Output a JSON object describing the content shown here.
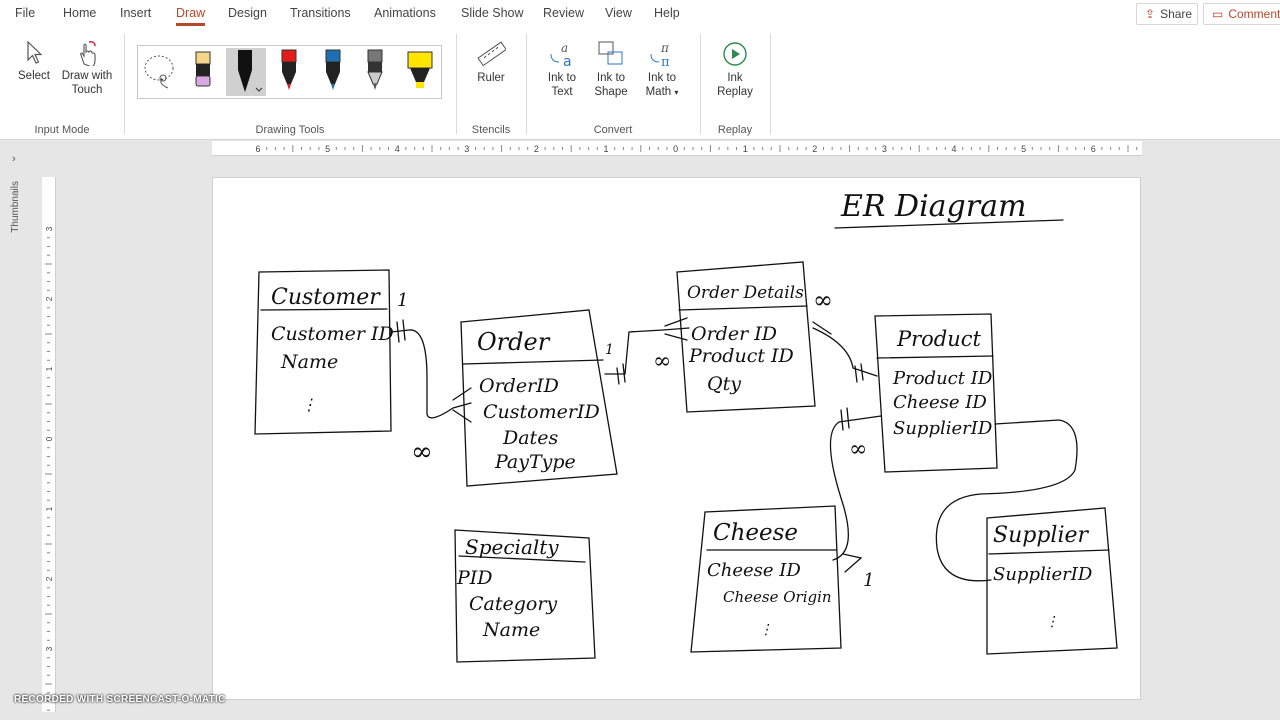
{
  "tabs": [
    {
      "label": "File"
    },
    {
      "label": "Home"
    },
    {
      "label": "Insert"
    },
    {
      "label": "Draw"
    },
    {
      "label": "Design"
    },
    {
      "label": "Transitions"
    },
    {
      "label": "Animations"
    },
    {
      "label": "Slide Show"
    },
    {
      "label": "Review"
    },
    {
      "label": "View"
    },
    {
      "label": "Help"
    }
  ],
  "top_right": {
    "share": "Share",
    "comments": "Comments"
  },
  "ribbon": {
    "select": "Select",
    "draw_with_touch": [
      "Draw with",
      "Touch"
    ],
    "input_mode": "Input Mode",
    "drawing_tools": "Drawing Tools",
    "ruler": "Ruler",
    "stencils": "Stencils",
    "ink_to_text": [
      "Ink to",
      "Text"
    ],
    "ink_to_shape": [
      "Ink to",
      "Shape"
    ],
    "ink_to_math": [
      "Ink to",
      "Math"
    ],
    "convert": "Convert",
    "ink_replay": [
      "Ink",
      "Replay"
    ],
    "replay": "Replay",
    "pen_colors": [
      "#111111",
      "#e41b1b",
      "#1f6fb2",
      "#777777",
      "#ffe600"
    ]
  },
  "thumbnails_label": "Thumbnails",
  "hruler_ticks": [
    "6",
    "5",
    "4",
    "3",
    "2",
    "1",
    "0",
    "1",
    "2",
    "3",
    "4",
    "5",
    "6"
  ],
  "vruler_ticks": [
    "3",
    "2",
    "1",
    "0",
    "1",
    "2",
    "3"
  ],
  "slide": {
    "title": "ER Diagram",
    "entities": {
      "customer": {
        "title": "Customer",
        "attrs": [
          "Customer ID",
          "Name",
          "⋮"
        ]
      },
      "order": {
        "title": "Order",
        "attrs": [
          "OrderID",
          "CustomerID",
          "Dates",
          "PayType"
        ]
      },
      "order_details": {
        "title": "Order Details",
        "attrs": [
          "Order ID",
          "Product ID",
          "Qty"
        ]
      },
      "product": {
        "title": "Product",
        "attrs": [
          "Product ID",
          "Cheese ID",
          "SupplierID"
        ]
      },
      "specialty": {
        "title": "Specialty",
        "attrs": [
          "PID",
          "Category",
          "Name"
        ]
      },
      "cheese": {
        "title": "Cheese",
        "attrs": [
          "Cheese ID",
          "Cheese Origin",
          "⋮"
        ]
      },
      "supplier": {
        "title": "Supplier",
        "attrs": [
          "SupplierID",
          "⋮"
        ]
      }
    },
    "marks": {
      "one": "1",
      "many": "∞",
      "one_bar": "‖"
    }
  },
  "watermark": "RECORDED WITH SCREENCAST-O-MATIC"
}
